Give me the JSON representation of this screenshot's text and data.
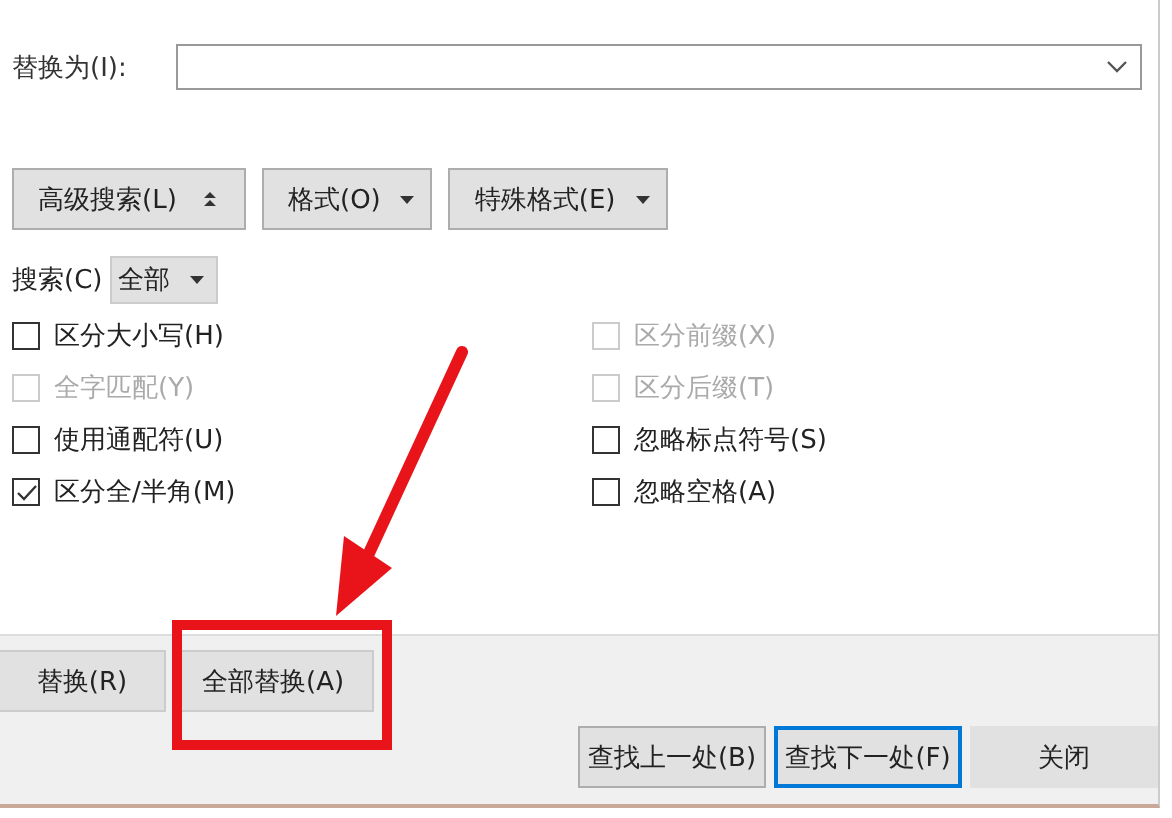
{
  "replace_field": {
    "label": "替换为(I):"
  },
  "option_buttons": [
    {
      "label": "高级搜索(L)",
      "kind": "toggle"
    },
    {
      "label": "格式(O)",
      "kind": "menu"
    },
    {
      "label": "特殊格式(E)",
      "kind": "menu"
    }
  ],
  "search_scope": {
    "label": "搜索(C)",
    "value": "全部"
  },
  "options_left": [
    {
      "label": "区分大小写(H)",
      "checked": false,
      "disabled": false
    },
    {
      "label": "全字匹配(Y)",
      "checked": false,
      "disabled": true
    },
    {
      "label": "使用通配符(U)",
      "checked": false,
      "disabled": false
    },
    {
      "label": "区分全/半角(M)",
      "checked": true,
      "disabled": false
    }
  ],
  "options_right": [
    {
      "label": "区分前缀(X)",
      "checked": false,
      "disabled": true
    },
    {
      "label": "区分后缀(T)",
      "checked": false,
      "disabled": true
    },
    {
      "label": "忽略标点符号(S)",
      "checked": false,
      "disabled": false
    },
    {
      "label": "忽略空格(A)",
      "checked": false,
      "disabled": false
    }
  ],
  "replace_buttons": [
    "替换(R)",
    "全部替换(A)"
  ],
  "footer_buttons": [
    {
      "label": "查找上一处(B)",
      "selected": false
    },
    {
      "label": "查找下一处(F)",
      "selected": true
    },
    {
      "label": "关闭",
      "selected": false
    }
  ]
}
